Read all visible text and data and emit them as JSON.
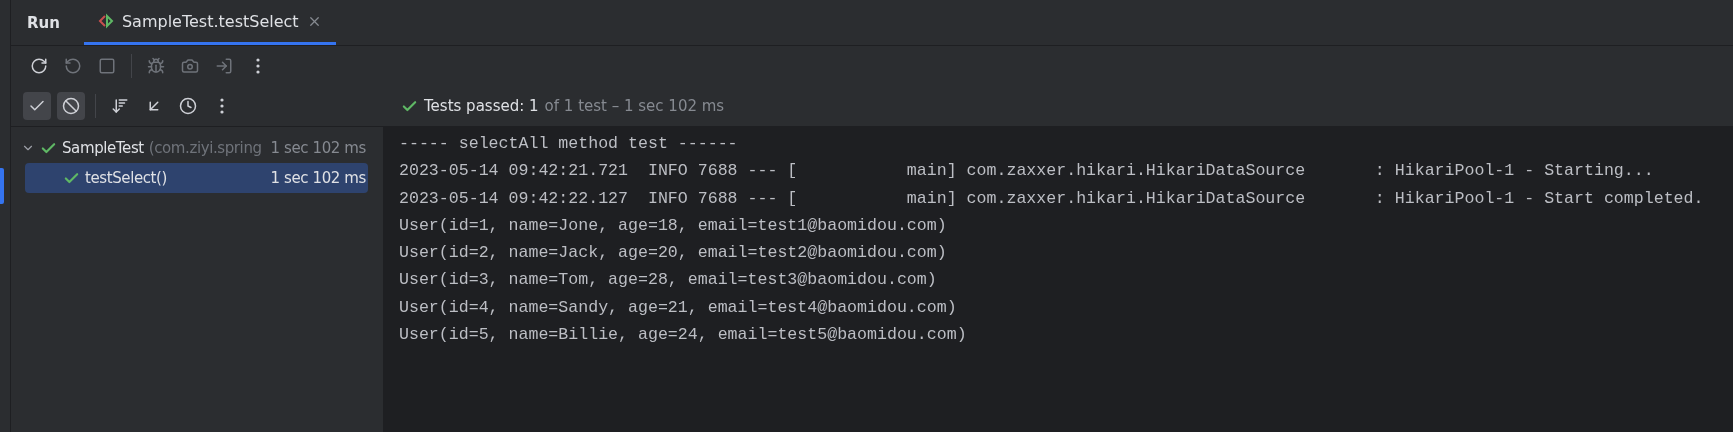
{
  "tool_window": {
    "title": "Run"
  },
  "tabs": [
    {
      "label": "SampleTest.testSelect",
      "selected": true,
      "closable": true
    }
  ],
  "toolbar": [
    {
      "kind": "rerun",
      "disabled": false
    },
    {
      "kind": "rerun-failed",
      "disabled": true
    },
    {
      "kind": "stop",
      "disabled": true
    },
    {
      "kind": "debug",
      "disabled": true
    },
    {
      "kind": "screenshot",
      "disabled": true
    },
    {
      "kind": "exit",
      "disabled": true
    },
    {
      "kind": "more",
      "disabled": false
    }
  ],
  "tree_toolbar": [
    {
      "kind": "show-passed",
      "selected": true
    },
    {
      "kind": "show-ignored",
      "selected": true
    },
    {
      "kind": "sort",
      "selected": false
    },
    {
      "kind": "collapse",
      "selected": false
    },
    {
      "kind": "history",
      "selected": false
    },
    {
      "kind": "more",
      "selected": false
    }
  ],
  "status": {
    "passed": true,
    "label": "Tests passed:",
    "count": "1",
    "detail": "of 1 test – 1 sec 102 ms"
  },
  "tree": [
    {
      "name": "SampleTest",
      "package": "(com.ziyi.spring",
      "time": "1 sec 102 ms",
      "passed": true,
      "expanded": true,
      "selected": false,
      "children": [
        {
          "name": "testSelect()",
          "time": "1 sec 102 ms",
          "passed": true,
          "selected": true
        }
      ]
    }
  ],
  "console": [
    "----- selectAll method test ------",
    "2023-05-14 09:42:21.721  INFO 7688 --- [           main] com.zaxxer.hikari.HikariDataSource       : HikariPool-1 - Starting...",
    "2023-05-14 09:42:22.127  INFO 7688 --- [           main] com.zaxxer.hikari.HikariDataSource       : HikariPool-1 - Start completed.",
    "User(id=1, name=Jone, age=18, email=test1@baomidou.com)",
    "User(id=2, name=Jack, age=20, email=test2@baomidou.com)",
    "User(id=3, name=Tom, age=28, email=test3@baomidou.com)",
    "User(id=4, name=Sandy, age=21, email=test4@baomidou.com)",
    "User(id=5, name=Billie, age=24, email=test5@baomidou.com)"
  ]
}
